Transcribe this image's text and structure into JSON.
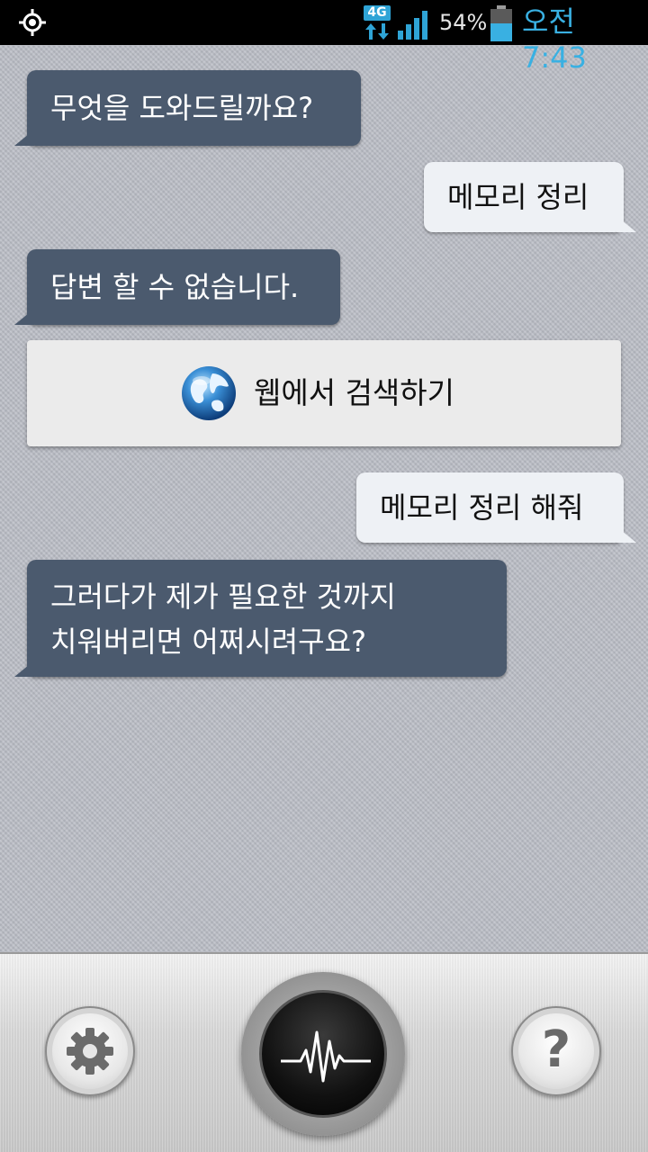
{
  "status_bar": {
    "network_type": "4G",
    "battery_percent": "54%",
    "time": "오전 7:43",
    "battery_level": 0.54,
    "icons": [
      "gps-icon",
      "data-arrows-icon",
      "signal-icon",
      "battery-icon"
    ],
    "time_color": "#39b0e2"
  },
  "conversation": [
    {
      "role": "assistant",
      "lines": [
        "무엇을 도와드릴까요?"
      ]
    },
    {
      "role": "user",
      "lines": [
        "메모리 정리"
      ]
    },
    {
      "role": "assistant",
      "lines": [
        "답변 할 수 없습니다."
      ]
    },
    {
      "role": "web_search",
      "label": "웹에서 검색하기",
      "icon": "globe-icon"
    },
    {
      "role": "user",
      "lines": [
        "메모리 정리 해줘"
      ]
    },
    {
      "role": "assistant",
      "lines": [
        "그러다가 제가 필요한 것까지",
        "치워버리면 어쩌시려구요?"
      ]
    }
  ],
  "bottom_bar": {
    "settings_icon": "gear-icon",
    "mic_icon": "voice-waveform-icon",
    "help_label": "?"
  },
  "colors": {
    "assistant_bubble": "#4b5a6e",
    "user_bubble": "#eef1f5",
    "background": "#b9bcc4"
  }
}
